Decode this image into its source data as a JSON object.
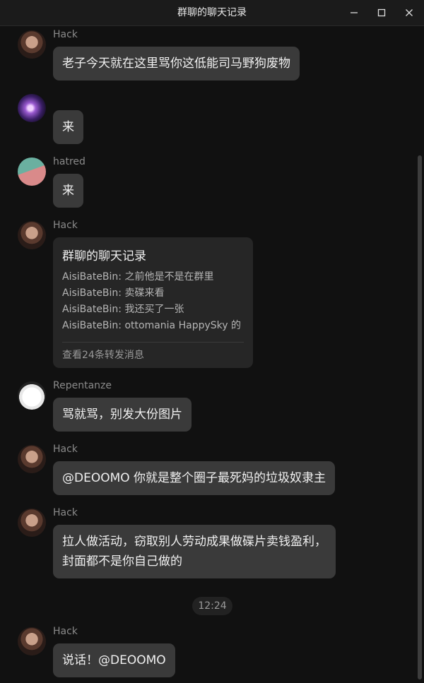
{
  "window": {
    "title": "群聊的聊天记录",
    "minimize_icon": "minimize-icon",
    "maximize_icon": "maximize-icon",
    "close_icon": "close-icon"
  },
  "messages": [
    {
      "sender": "Hack",
      "text": "老子今天就在这里骂你这低能司马野狗废物"
    },
    {
      "sender": "",
      "text": "来"
    },
    {
      "sender": "hatred",
      "text": "来"
    },
    {
      "sender": "Hack",
      "forward": {
        "title": "群聊的聊天记录",
        "lines": [
          "AisiBateBin: 之前他是不是在群里",
          "AisiBateBin: 卖碟来看",
          "AisiBateBin: 我还买了一张",
          "AisiBateBin: ottomania HappySky 的"
        ],
        "footer": "查看24条转发消息"
      }
    },
    {
      "sender": "Repentanze",
      "text": "骂就骂，别发大份图片"
    },
    {
      "sender": "Hack",
      "text": "@DEOOMO 你就是整个圈子最死妈的垃圾奴隶主"
    },
    {
      "sender": "Hack",
      "text_line1": "拉人做活动，窃取别人劳动成果做碟片卖钱盈利，",
      "text_line2": "封面都不是你自己做的"
    },
    {
      "sender": "Hack",
      "text": "说话！@DEOOMO"
    }
  ],
  "time_divider": "12:24"
}
